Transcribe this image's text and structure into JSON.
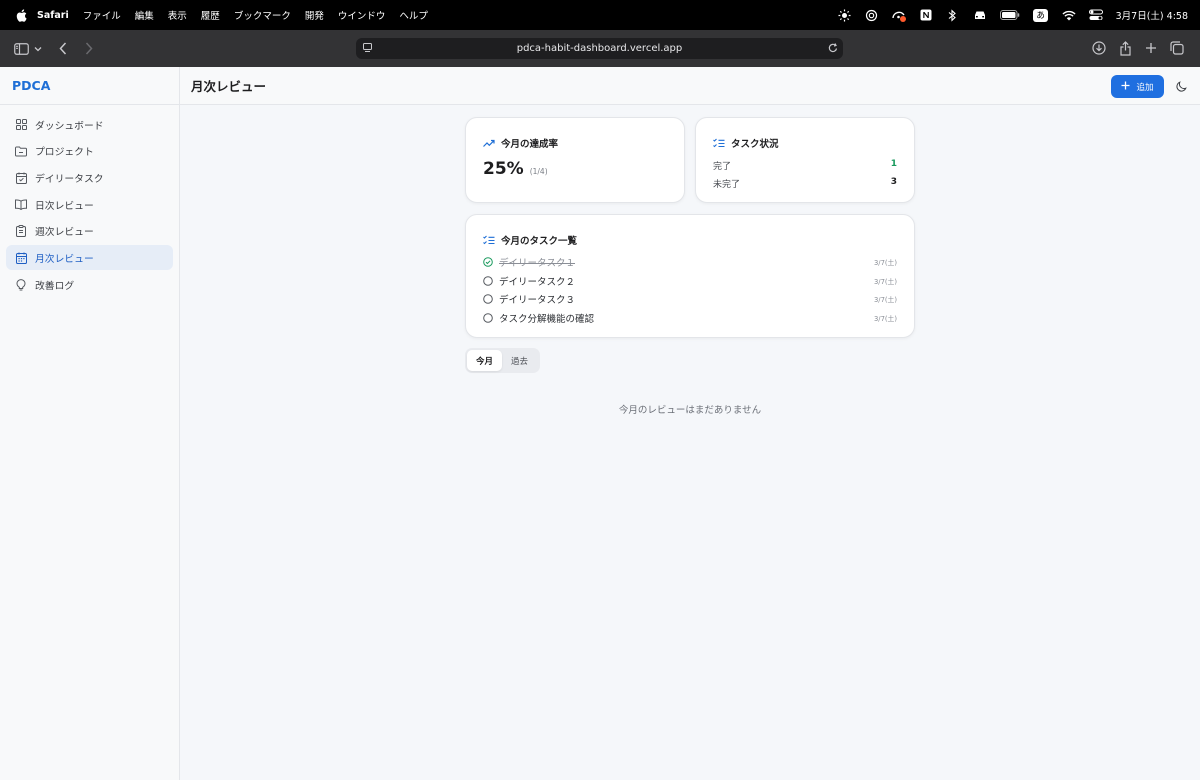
{
  "menubar": {
    "app_name": "Safari",
    "items": [
      "ファイル",
      "編集",
      "表示",
      "履歴",
      "ブックマーク",
      "開発",
      "ウインドウ",
      "ヘルプ"
    ],
    "ime": "あ",
    "clock": "3月7日(土) 4:58"
  },
  "browser": {
    "url": "pdca-habit-dashboard.vercel.app"
  },
  "sidebar": {
    "brand": "PDCA",
    "items": [
      {
        "label": "ダッシュボード",
        "icon": "grid-icon"
      },
      {
        "label": "プロジェクト",
        "icon": "folder-icon"
      },
      {
        "label": "デイリータスク",
        "icon": "calendar-check-icon"
      },
      {
        "label": "日次レビュー",
        "icon": "book-icon"
      },
      {
        "label": "週次レビュー",
        "icon": "clipboard-icon"
      },
      {
        "label": "月次レビュー",
        "icon": "calendar-icon"
      },
      {
        "label": "改善ログ",
        "icon": "lightbulb-icon"
      }
    ],
    "active_index": 5
  },
  "header": {
    "title": "月次レビュー",
    "add_label": "追加"
  },
  "rate_card": {
    "title": "今月の達成率",
    "value": "25%",
    "detail": "(1/4)"
  },
  "status_card": {
    "title": "タスク状況",
    "done_label": "完了",
    "done_value": "1",
    "todo_label": "未完了",
    "todo_value": "3"
  },
  "tasks_card": {
    "title": "今月のタスク一覧",
    "tasks": [
      {
        "name": "デイリータスク１",
        "date": "3/7(土)",
        "done": true
      },
      {
        "name": "デイリータスク２",
        "date": "3/7(土)",
        "done": false
      },
      {
        "name": "デイリータスク３",
        "date": "3/7(土)",
        "done": false
      },
      {
        "name": "タスク分解機能の確認",
        "date": "3/7(土)",
        "done": false
      }
    ]
  },
  "tabs": {
    "current": "今月",
    "past": "過去"
  },
  "empty_message": "今月のレビューはまだありません",
  "colors": {
    "accent": "#1f6fe0",
    "success": "#1a9a5e",
    "active_nav_bg": "#e6edf7"
  }
}
